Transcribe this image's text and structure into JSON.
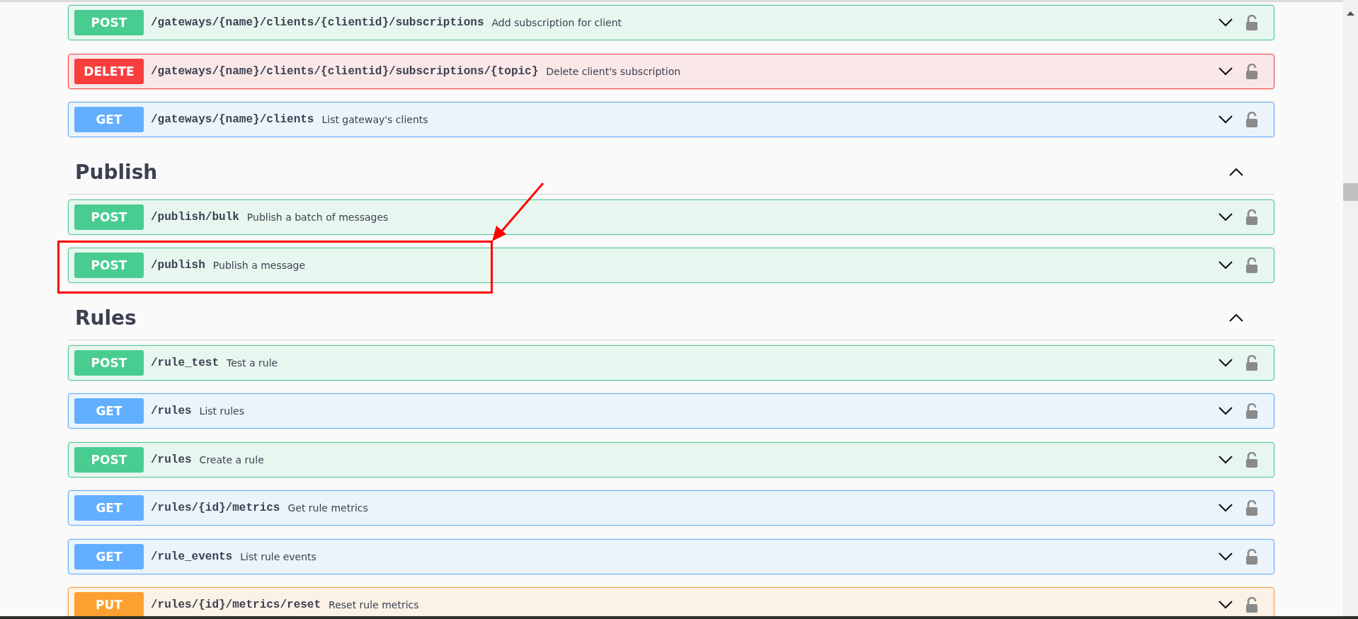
{
  "sections": [
    {
      "operations": [
        {
          "kind": "post",
          "method": "POST",
          "path": "/gateways/{name}/clients/{clientid}/subscriptions",
          "summary": "Add subscription for client",
          "expanded": false,
          "locked": false,
          "highlighted": false
        },
        {
          "kind": "delete",
          "method": "DELETE",
          "path": "/gateways/{name}/clients/{clientid}/subscriptions/{topic}",
          "summary": "Delete client's subscription",
          "expanded": false,
          "locked": false,
          "highlighted": false
        },
        {
          "kind": "get",
          "method": "GET",
          "path": "/gateways/{name}/clients",
          "summary": "List gateway's clients",
          "expanded": false,
          "locked": false,
          "highlighted": false
        }
      ]
    },
    {
      "title": "Publish",
      "expanded": true,
      "operations": [
        {
          "kind": "post",
          "method": "POST",
          "path": "/publish/bulk",
          "summary": "Publish a batch of messages",
          "expanded": false,
          "locked": false,
          "highlighted": false
        },
        {
          "kind": "post",
          "method": "POST",
          "path": "/publish",
          "summary": "Publish a message",
          "expanded": false,
          "locked": false,
          "highlighted": true
        }
      ]
    },
    {
      "title": "Rules",
      "expanded": true,
      "operations": [
        {
          "kind": "post",
          "method": "POST",
          "path": "/rule_test",
          "summary": "Test a rule",
          "expanded": false,
          "locked": false,
          "highlighted": false
        },
        {
          "kind": "get",
          "method": "GET",
          "path": "/rules",
          "summary": "List rules",
          "expanded": false,
          "locked": false,
          "highlighted": false
        },
        {
          "kind": "post",
          "method": "POST",
          "path": "/rules",
          "summary": "Create a rule",
          "expanded": false,
          "locked": false,
          "highlighted": false
        },
        {
          "kind": "get",
          "method": "GET",
          "path": "/rules/{id}/metrics",
          "summary": "Get rule metrics",
          "expanded": false,
          "locked": false,
          "highlighted": false
        },
        {
          "kind": "get",
          "method": "GET",
          "path": "/rule_events",
          "summary": "List rule events",
          "expanded": false,
          "locked": false,
          "highlighted": false
        },
        {
          "kind": "put",
          "method": "PUT",
          "path": "/rules/{id}/metrics/reset",
          "summary": "Reset rule metrics",
          "expanded": false,
          "locked": false,
          "highlighted": false
        }
      ]
    }
  ]
}
